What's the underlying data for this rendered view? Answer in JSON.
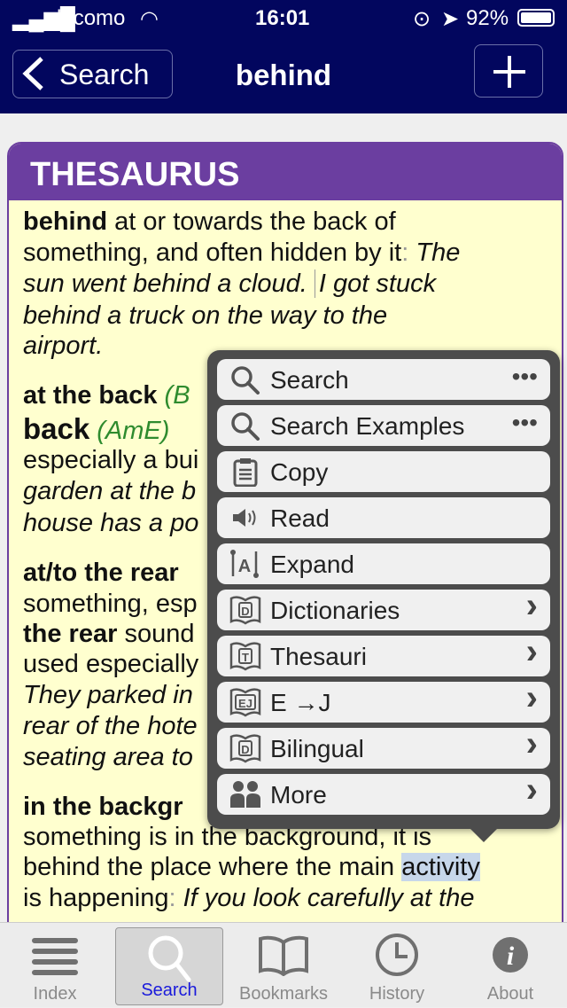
{
  "status": {
    "carrier": "docomo",
    "time": "16:01",
    "battery": "92%"
  },
  "nav": {
    "back_label": "Search",
    "title": "behind"
  },
  "card": {
    "heading": "THESAURUS"
  },
  "entry": {
    "l1a": "behind",
    "l1b": " at or towards the back of",
    "l2a": "something, and often hidden by it",
    "l2b": ": ",
    "l2c": "The",
    "l3": "sun went behind a cloud. ",
    "l3b": "I got stuck",
    "l4": "behind a truck on the way to the",
    "l5": "airport.",
    "l6a": "at the back",
    "l6b": " (B",
    "l7a": "back",
    "l7b": " (AmE)",
    "l8": "especially a bui",
    "l9": "garden at the b",
    "l10": "house has a po",
    "l11": "at/to the rear",
    "l12": "something, esp",
    "l13a": "the rear",
    "l13b": " sound",
    "l14": "used especially",
    "l15": "They parked in",
    "l16": "rear of the hote",
    "l17": "seating area to",
    "l18": "in the backgr",
    "l19": "something is in the background, it is",
    "l20a": "behind the place where the main ",
    "l20b": "activity",
    "l21a": "is happening",
    "l21b": ": ",
    "l21c": "If you look carefully at the"
  },
  "menu": [
    {
      "label": "Search",
      "icon": "search-icon",
      "trail": "•••"
    },
    {
      "label": "Search Examples",
      "icon": "search-icon",
      "trail": "•••"
    },
    {
      "label": "Copy",
      "icon": "clipboard-icon",
      "trail": ""
    },
    {
      "label": "Read",
      "icon": "speaker-icon",
      "trail": ""
    },
    {
      "label": "Expand",
      "icon": "expand-icon",
      "trail": ""
    },
    {
      "label": "Dictionaries",
      "icon": "book-d-icon",
      "trail": "›"
    },
    {
      "label": "Thesauri",
      "icon": "book-t-icon",
      "trail": "›"
    },
    {
      "label": "E →J",
      "icon": "book-ej-icon",
      "trail": "›"
    },
    {
      "label": "Bilingual",
      "icon": "book-d-icon",
      "trail": "›"
    },
    {
      "label": "More",
      "icon": "people-icon",
      "trail": "›"
    }
  ],
  "tabs": [
    {
      "label": "Index"
    },
    {
      "label": "Search"
    },
    {
      "label": "Bookmarks"
    },
    {
      "label": "History"
    },
    {
      "label": "About"
    }
  ],
  "colors": {
    "nav": "#02065e",
    "thesaurus": "#6b3ea0",
    "card_bg": "#ffffcf",
    "active_tab": "#1a1adb",
    "variant": "#2e8b2e"
  }
}
